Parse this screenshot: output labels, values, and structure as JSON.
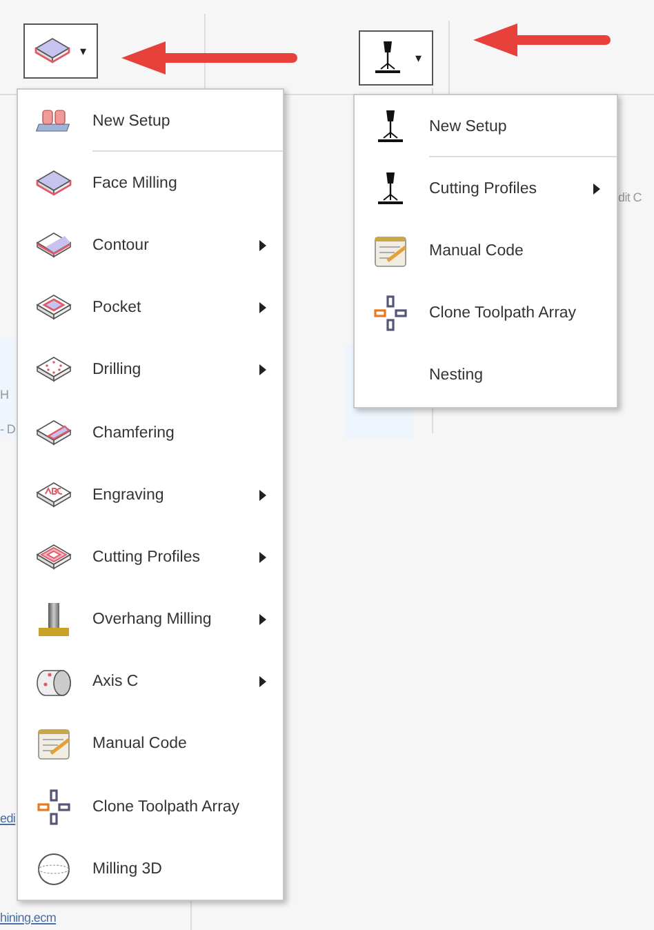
{
  "background": {
    "texts": [
      {
        "text": "H",
        "kind": "plain"
      },
      {
        "text": "- D",
        "kind": "plain"
      },
      {
        "text": "edi",
        "kind": "link"
      },
      {
        "text": "hining.ecm",
        "kind": "link"
      },
      {
        "text": "dit C",
        "kind": "plain"
      }
    ]
  },
  "toolbar": {
    "buttons": [
      {
        "caret": "▾"
      },
      {
        "caret": "▾"
      }
    ]
  },
  "milling_menu": {
    "items": [
      {
        "label": "New Setup",
        "submenu": false,
        "separator_after": true
      },
      {
        "label": "Face Milling",
        "submenu": false,
        "separator_after": false
      },
      {
        "label": "Contour",
        "submenu": true,
        "separator_after": false
      },
      {
        "label": "Pocket",
        "submenu": true,
        "separator_after": false
      },
      {
        "label": "Drilling",
        "submenu": true,
        "separator_after": false
      },
      {
        "label": "Chamfering",
        "submenu": false,
        "separator_after": false
      },
      {
        "label": "Engraving",
        "submenu": true,
        "separator_after": false
      },
      {
        "label": "Cutting Profiles",
        "submenu": true,
        "separator_after": false
      },
      {
        "label": "Overhang Milling",
        "submenu": true,
        "separator_after": false
      },
      {
        "label": "Axis C",
        "submenu": true,
        "separator_after": false
      },
      {
        "label": "Manual Code",
        "submenu": false,
        "separator_after": false
      },
      {
        "label": "Clone Toolpath Array",
        "submenu": false,
        "separator_after": false
      },
      {
        "label": "Milling 3D",
        "submenu": false,
        "separator_after": false
      }
    ]
  },
  "cutting_menu": {
    "items": [
      {
        "label": "New Setup",
        "submenu": false,
        "separator_after": true
      },
      {
        "label": "Cutting Profiles",
        "submenu": true,
        "separator_after": false
      },
      {
        "label": "Manual Code",
        "submenu": false,
        "separator_after": false
      },
      {
        "label": "Clone Toolpath Array",
        "submenu": false,
        "separator_after": false
      },
      {
        "label": "Nesting",
        "submenu": false,
        "separator_after": false
      }
    ]
  }
}
